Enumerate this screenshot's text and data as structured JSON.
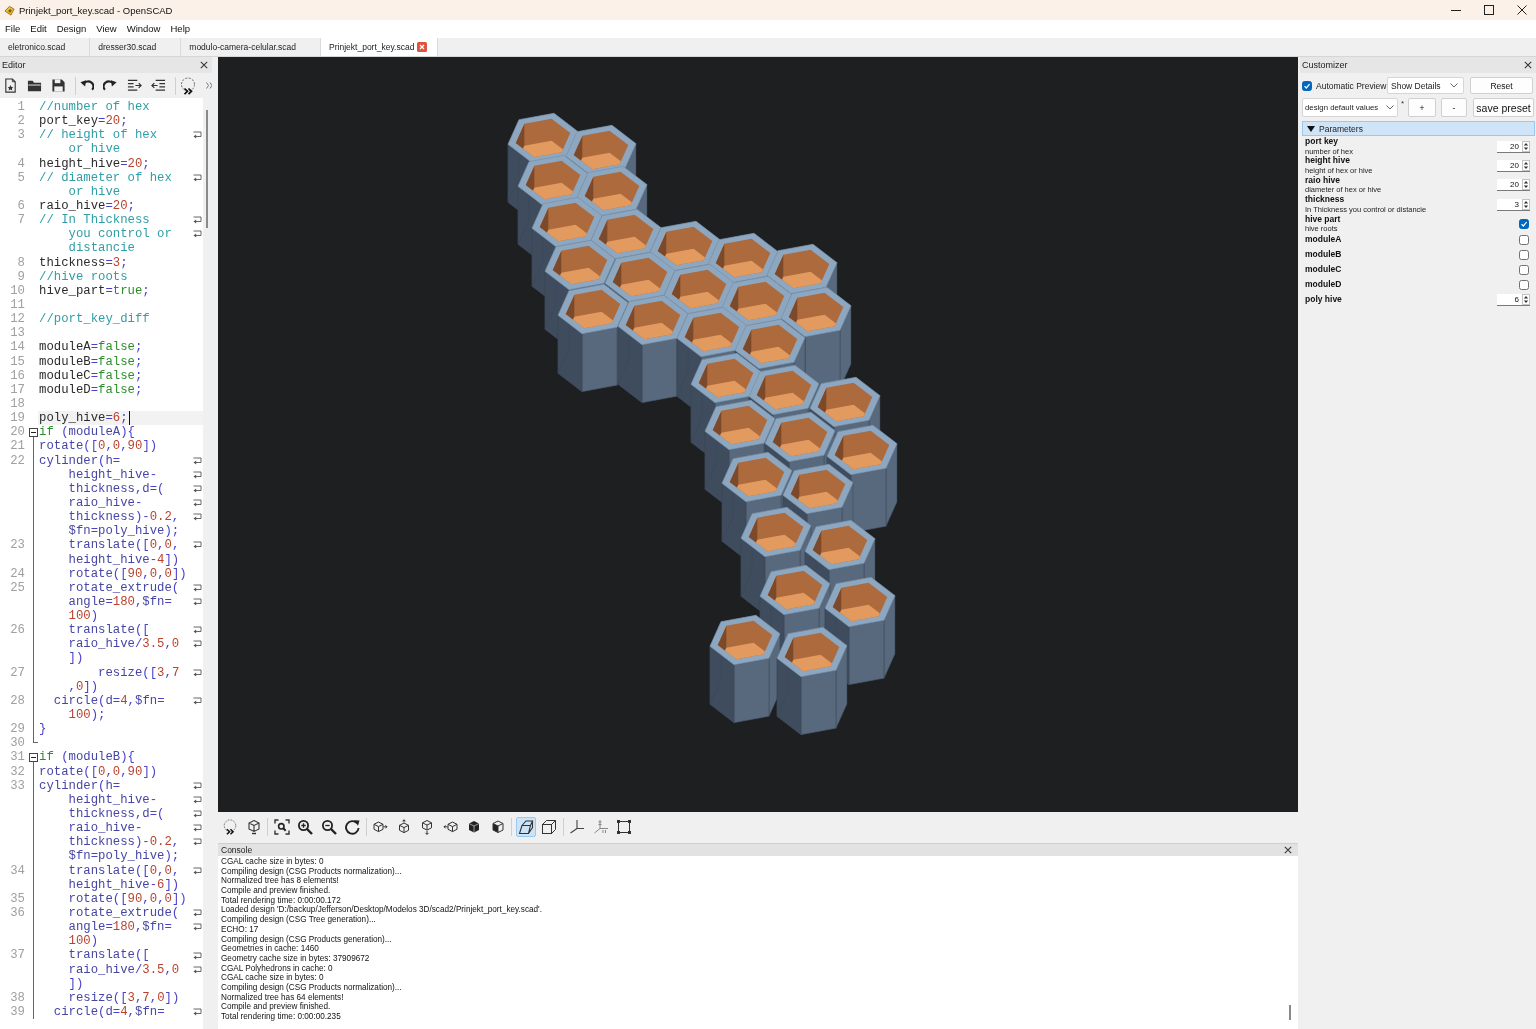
{
  "window": {
    "title": "Prinjekt_port_key.scad - OpenSCAD"
  },
  "menu": [
    "File",
    "Edit",
    "Design",
    "View",
    "Window",
    "Help"
  ],
  "tabs": [
    {
      "label": "eletronico.scad",
      "selected": false
    },
    {
      "label": "dresser30.scad",
      "selected": false
    },
    {
      "label": "modulo-camera-celular.scad",
      "selected": false
    },
    {
      "label": "Prinjekt_port_key.scad",
      "selected": true
    }
  ],
  "editor": {
    "title": "Editor",
    "lines": [
      {
        "number": "1",
        "kind": "plain",
        "current": false,
        "rows": [
          [
            {
              "kind": "comment",
              "text": "//number of hex"
            }
          ]
        ]
      },
      {
        "number": "2",
        "kind": "plain",
        "current": false,
        "rows": [
          [
            {
              "kind": "name",
              "text": "port_key=20;"
            }
          ]
        ]
      },
      {
        "number": "3",
        "kind": "plain",
        "current": false,
        "rows": [
          [
            {
              "kind": "comment",
              "text": "// height of hex"
            }
          ],
          [
            {
              "kind": "comment",
              "text": "or hive"
            }
          ]
        ]
      },
      {
        "number": "4",
        "kind": "plain",
        "current": false,
        "rows": [
          [
            {
              "kind": "name",
              "text": "height_hive=20;"
            }
          ]
        ]
      },
      {
        "number": "5",
        "kind": "plain",
        "current": false,
        "rows": [
          [
            {
              "kind": "comment",
              "text": "// diameter of hex"
            }
          ],
          [
            {
              "kind": "comment",
              "text": "or hive"
            }
          ]
        ]
      },
      {
        "number": "6",
        "kind": "plain",
        "current": false,
        "rows": [
          [
            {
              "kind": "name",
              "text": "raio_hive=20;"
            }
          ]
        ]
      },
      {
        "number": "7",
        "kind": "plain",
        "current": false,
        "rows": [
          [
            {
              "kind": "comment",
              "text": "// In Thickness"
            }
          ],
          [
            {
              "kind": "comment",
              "text": "you control or"
            }
          ],
          [
            {
              "kind": "comment",
              "text": "distancie"
            }
          ]
        ]
      },
      {
        "number": "8",
        "kind": "plain",
        "current": false,
        "rows": [
          [
            {
              "kind": "name",
              "text": "thickness=3;"
            }
          ]
        ]
      },
      {
        "number": "9",
        "kind": "plain",
        "current": false,
        "rows": [
          [
            {
              "kind": "comment",
              "text": "//hive roots"
            }
          ]
        ]
      },
      {
        "number": "10",
        "kind": "plain",
        "current": false,
        "rows": [
          [
            {
              "kind": "name",
              "text": "hive_part="
            },
            {
              "kind": "keyword",
              "text": "true;"
            }
          ]
        ]
      },
      {
        "number": "11",
        "kind": "plain",
        "current": false
      },
      {
        "number": "12",
        "kind": "plain",
        "current": false,
        "rows": [
          [
            {
              "kind": "comment",
              "text": "//port_key_diff"
            }
          ]
        ]
      },
      {
        "number": "13",
        "kind": "plain",
        "current": false
      },
      {
        "number": "14",
        "kind": "plain",
        "current": false,
        "rows": [
          [
            {
              "kind": "name",
              "text": "moduleA="
            },
            {
              "kind": "keyword",
              "text": "false;"
            }
          ]
        ]
      },
      {
        "number": "15",
        "kind": "plain",
        "current": false,
        "rows": [
          [
            {
              "kind": "name",
              "text": "moduleB="
            },
            {
              "kind": "keyword",
              "text": "false;"
            }
          ]
        ]
      },
      {
        "number": "16",
        "kind": "plain",
        "current": false,
        "rows": [
          [
            {
              "kind": "name",
              "text": "moduleC="
            },
            {
              "kind": "keyword",
              "text": "false;"
            }
          ]
        ]
      },
      {
        "number": "17",
        "kind": "plain",
        "current": false,
        "rows": [
          [
            {
              "kind": "name",
              "text": "moduleD="
            },
            {
              "kind": "keyword",
              "text": "false;"
            }
          ]
        ]
      },
      {
        "number": "18",
        "kind": "plain",
        "current": false
      },
      {
        "number": "19",
        "kind": "plain",
        "current": true,
        "rows": [
          [
            {
              "kind": "name",
              "text": "poly_hive=6;"
            }
          ]
        ]
      },
      {
        "number": "20",
        "kind": "opener",
        "current": false,
        "expanded": true,
        "rows": [
          [
            {
              "kind": "keyword",
              "text": "if"
            },
            {
              "kind": "call",
              "text": " (moduleA){"
            }
          ]
        ]
      },
      {
        "number": "21",
        "kind": "inner",
        "current": false,
        "rows": [
          [
            {
              "kind": "call",
              "text": "rotate([0,0,90])"
            }
          ]
        ]
      },
      {
        "number": "22",
        "kind": "inner",
        "current": false,
        "rows": [
          [
            {
              "kind": "call",
              "text": "cylinder(h="
            }
          ],
          [
            {
              "kind": "call",
              "text": "height_hive-"
            }
          ],
          [
            {
              "kind": "call",
              "text": "thickness,d=("
            }
          ],
          [
            {
              "kind": "call",
              "text": "raio_hive-"
            }
          ],
          [
            {
              "kind": "call",
              "text": "thickness)-0.2,"
            }
          ],
          [
            {
              "kind": "call",
              "text": "$fn=poly_hive);"
            }
          ]
        ]
      },
      {
        "number": "23",
        "kind": "inner",
        "current": false,
        "rows": [
          [
            {
              "kind": "call",
              "text": "    translate([0,0,"
            }
          ],
          [
            {
              "kind": "call",
              "text": "height_hive-4])"
            }
          ]
        ]
      },
      {
        "number": "24",
        "kind": "inner",
        "current": false,
        "rows": [
          [
            {
              "kind": "call",
              "text": "    rotate([90,0,0])"
            }
          ]
        ]
      },
      {
        "number": "25",
        "kind": "inner",
        "current": false,
        "rows": [
          [
            {
              "kind": "call",
              "text": "    rotate_extrude("
            }
          ],
          [
            {
              "kind": "call",
              "text": "angle=180,$fn="
            }
          ],
          [
            {
              "kind": "call",
              "text": "100)"
            }
          ]
        ]
      },
      {
        "number": "26",
        "kind": "inner",
        "current": false,
        "rows": [
          [
            {
              "kind": "call",
              "text": "    translate(["
            }
          ],
          [
            {
              "kind": "call",
              "text": "raio_hive/3.5,0"
            }
          ],
          [
            {
              "kind": "call",
              "text": "])"
            }
          ]
        ]
      },
      {
        "number": "27",
        "kind": "inner",
        "current": false,
        "rows": [
          [
            {
              "kind": "call",
              "text": "        resize([3,7"
            }
          ],
          [
            {
              "kind": "call",
              "text": ",0])"
            }
          ]
        ]
      },
      {
        "number": "28",
        "kind": "inner",
        "current": false,
        "rows": [
          [
            {
              "kind": "call",
              "text": "  circle(d=4,$fn="
            }
          ],
          [
            {
              "kind": "call",
              "text": "100);"
            }
          ]
        ]
      },
      {
        "number": "29",
        "kind": "inner",
        "current": false,
        "rows": [
          [
            {
              "kind": "call",
              "text": "}"
            }
          ]
        ]
      },
      {
        "number": "30",
        "kind": "closer",
        "current": false
      },
      {
        "number": "31",
        "kind": "opener",
        "current": false,
        "expanded": true,
        "rows": [
          [
            {
              "kind": "keyword",
              "text": "if"
            },
            {
              "kind": "call",
              "text": " (moduleB){"
            }
          ]
        ]
      },
      {
        "number": "32",
        "kind": "inner",
        "current": false,
        "rows": [
          [
            {
              "kind": "call",
              "text": "rotate([0,0,90])"
            }
          ]
        ]
      },
      {
        "number": "33",
        "kind": "inner",
        "current": false,
        "rows": [
          [
            {
              "kind": "call",
              "text": "cylinder(h="
            }
          ],
          [
            {
              "kind": "call",
              "text": "height_hive-"
            }
          ],
          [
            {
              "kind": "call",
              "text": "thickness,d=("
            }
          ],
          [
            {
              "kind": "call",
              "text": "raio_hive-"
            }
          ],
          [
            {
              "kind": "call",
              "text": "thickness)-0.2,"
            }
          ],
          [
            {
              "kind": "call",
              "text": "$fn=poly_hive);"
            }
          ]
        ]
      },
      {
        "number": "34",
        "kind": "inner",
        "current": false,
        "rows": [
          [
            {
              "kind": "call",
              "text": "    translate([0,0,"
            }
          ],
          [
            {
              "kind": "call",
              "text": "height_hive-6])"
            }
          ]
        ]
      },
      {
        "number": "35",
        "kind": "inner",
        "current": false,
        "rows": [
          [
            {
              "kind": "call",
              "text": "    rotate([90,0,0])"
            }
          ]
        ]
      },
      {
        "number": "36",
        "kind": "inner",
        "current": false,
        "rows": [
          [
            {
              "kind": "call",
              "text": "    rotate_extrude("
            }
          ],
          [
            {
              "kind": "call",
              "text": "angle=180,$fn="
            }
          ],
          [
            {
              "kind": "call",
              "text": "100)"
            }
          ]
        ]
      },
      {
        "number": "37",
        "kind": "inner",
        "current": false,
        "rows": [
          [
            {
              "kind": "call",
              "text": "    translate(["
            }
          ],
          [
            {
              "kind": "call",
              "text": "raio_hive/3.5,0"
            }
          ],
          [
            {
              "kind": "call",
              "text": "])"
            }
          ]
        ]
      },
      {
        "number": "38",
        "kind": "inner",
        "current": false,
        "rows": [
          [
            {
              "kind": "call",
              "text": "    resize([3,7,0])"
            }
          ]
        ]
      },
      {
        "number": "39",
        "kind": "inner",
        "current": false,
        "continued": true,
        "rows": [
          [
            {
              "kind": "call",
              "text": "  circle(d=4,$fn="
            }
          ]
        ]
      }
    ]
  },
  "viewer": {
    "perspective": true
  },
  "console": {
    "title": "Console",
    "lines": [
      "CGAL cache size in bytes: 0",
      "Compiling design (CSG Products normalization)...",
      "Normalized tree has 8 elements!",
      "Compile and preview finished.",
      "Total rendering time: 0:00:00.172",
      "Loaded design 'D:/backup/Jefferson/Desktop/Modelos 3D/scad2/Prinjekt_port_key.scad'.",
      "Compiling design (CSG Tree generation)...",
      "ECHO: 17",
      "Compiling design (CSG Products generation)...",
      "Geometries in cache: 1460",
      "Geometry cache size in bytes: 37909672",
      "CGAL Polyhedrons in cache: 0",
      "CGAL cache size in bytes: 0",
      "Compiling design (CSG Products normalization)...",
      "Normalized tree has 64 elements!",
      "Compile and preview finished.",
      "Total rendering time: 0:00:00.235"
    ]
  },
  "customizer": {
    "title": "Customizer",
    "automatic_preview": {
      "label": "Automatic Preview",
      "checked": true
    },
    "details": "Show Details",
    "reset": "Reset",
    "preset": "design default values",
    "preset_marker": "*",
    "add": "+",
    "remove": "-",
    "save": "save preset",
    "group": {
      "title": "Parameters",
      "expanded": true
    },
    "parameters": [
      {
        "kind": "number",
        "name": "port key",
        "description": "number of hex",
        "value": "20"
      },
      {
        "kind": "number",
        "name": "height hive",
        "description": "height of hex or hive",
        "value": "20"
      },
      {
        "kind": "number",
        "name": "raio hive",
        "description": "diameter of hex or hive",
        "value": "20"
      },
      {
        "kind": "number",
        "name": "thickness",
        "description": "In Thickness you control or distancie",
        "value": "3"
      },
      {
        "kind": "checkbox",
        "name": "hive part",
        "description": "hive roots",
        "checked": true
      },
      {
        "kind": "checkbox",
        "name": "moduleA",
        "checked": false
      },
      {
        "kind": "checkbox",
        "name": "moduleB",
        "checked": false
      },
      {
        "kind": "checkbox",
        "name": "moduleC",
        "checked": false
      },
      {
        "kind": "checkbox",
        "name": "moduleD",
        "checked": false
      },
      {
        "kind": "number",
        "name": "poly hive",
        "value": "6"
      }
    ]
  }
}
